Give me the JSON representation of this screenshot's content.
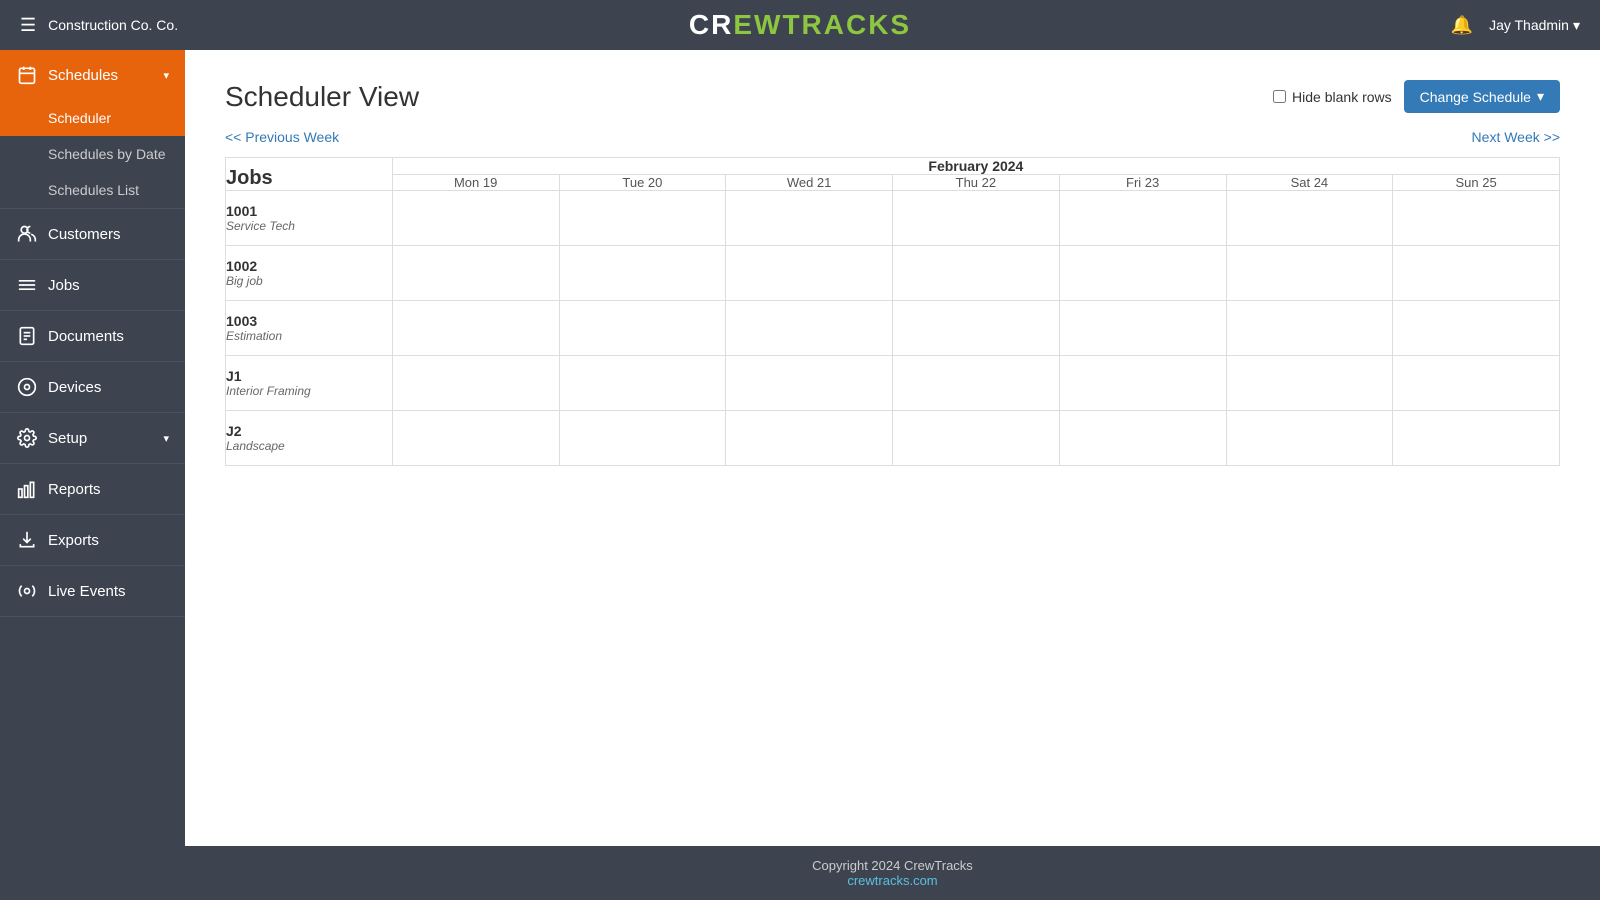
{
  "header": {
    "hamburger": "☰",
    "company": "Construction Co. Co.",
    "logo_crew": "CR",
    "logo_ewtracks": "EWTRACKS",
    "bell": "🔔",
    "user": "Jay Thadmin",
    "user_chevron": "▾"
  },
  "sidebar": {
    "schedules_label": "Schedules",
    "scheduler_label": "Scheduler",
    "schedules_by_date_label": "Schedules by Date",
    "schedules_list_label": "Schedules List",
    "customers_label": "Customers",
    "jobs_label": "Jobs",
    "documents_label": "Documents",
    "devices_label": "Devices",
    "setup_label": "Setup",
    "reports_label": "Reports",
    "exports_label": "Exports",
    "live_events_label": "Live Events"
  },
  "main": {
    "page_title": "Scheduler View",
    "hide_blank_label": "Hide blank rows",
    "change_schedule_btn": "Change Schedule",
    "prev_week": "<< Previous Week",
    "next_week": "Next Week >>",
    "month_header": "February 2024",
    "days": [
      {
        "label": "Mon 19"
      },
      {
        "label": "Tue 20"
      },
      {
        "label": "Wed 21"
      },
      {
        "label": "Thu 22"
      },
      {
        "label": "Fri 23"
      },
      {
        "label": "Sat 24"
      },
      {
        "label": "Sun 25"
      }
    ],
    "jobs_col": "Jobs",
    "jobs": [
      {
        "number": "1001",
        "desc": "Service Tech"
      },
      {
        "number": "1002",
        "desc": "Big job"
      },
      {
        "number": "1003",
        "desc": "Estimation"
      },
      {
        "number": "J1",
        "desc": "Interior Framing"
      },
      {
        "number": "J2",
        "desc": "Landscape"
      }
    ]
  },
  "footer": {
    "copyright": "Copyright 2024 CrewTracks",
    "link_text": "crewtracks.com",
    "link_url": "#"
  }
}
